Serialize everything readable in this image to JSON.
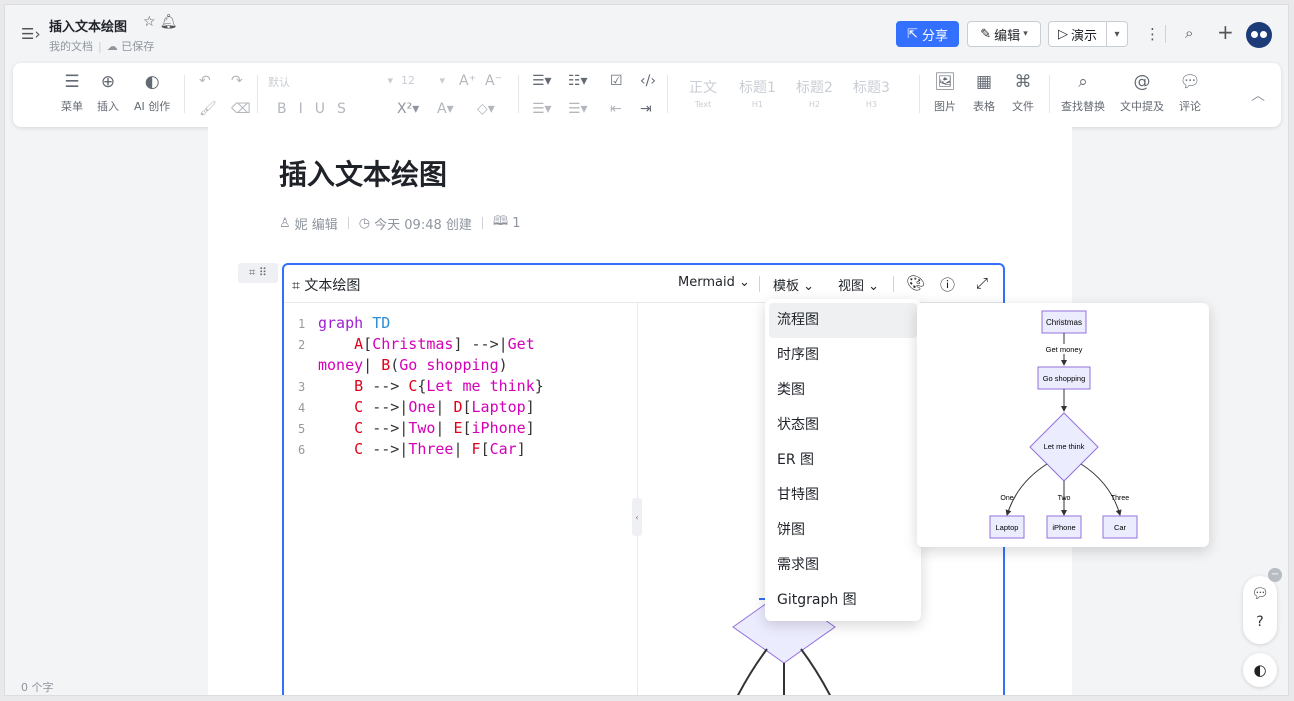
{
  "header": {
    "title": "插入文本绘图",
    "breadcrumb": "我的文档",
    "save_status": "已保存",
    "share_label": "分享",
    "edit_label": "编辑",
    "present_label": "演示"
  },
  "toolbar": {
    "menu": "菜单",
    "insert": "插入",
    "ai": "AI 创作",
    "font_placeholder": "默认",
    "font_size": "12",
    "headings": [
      {
        "label": "正文",
        "sub": "Text"
      },
      {
        "label": "标题1",
        "sub": "H1"
      },
      {
        "label": "标题2",
        "sub": "H2"
      },
      {
        "label": "标题3",
        "sub": "H3"
      }
    ],
    "image": "图片",
    "table": "表格",
    "file": "文件",
    "find_replace": "查找替换",
    "mention": "文中提及",
    "comment": "评论"
  },
  "doc": {
    "heading": "插入文本绘图",
    "author": "妮 编辑",
    "created": "今天 09:48 创建",
    "reads": "1"
  },
  "block": {
    "title": "文本绘图",
    "engine": "Mermaid",
    "template_label": "模板",
    "view_label": "视图"
  },
  "code": {
    "lines": [
      {
        "n": "1"
      },
      {
        "n": "2"
      },
      {
        "n": "3"
      },
      {
        "n": "4"
      },
      {
        "n": "5"
      },
      {
        "n": "6"
      }
    ]
  },
  "template_menu": {
    "items": [
      "流程图",
      "时序图",
      "类图",
      "状态图",
      "ER 图",
      "甘特图",
      "饼图",
      "需求图",
      "Gitgraph 图"
    ]
  },
  "diagram": {
    "nodes": {
      "a": "Christmas",
      "b": "Go shopping",
      "c": "Let me think",
      "d": "Laptop",
      "e": "iPhone",
      "f": "Car"
    },
    "edges": {
      "ab": "Get money",
      "cd": "One",
      "ce": "Two",
      "cf": "Three"
    }
  },
  "status": {
    "word_count": "0 个字"
  },
  "colors": {
    "accent": "#3370ff",
    "node_fill": "#ececff",
    "node_stroke": "#9370db"
  },
  "icons": [
    "menu-toggle-icon",
    "star-icon",
    "bell-icon",
    "share-icon",
    "pencil-icon",
    "present-icon",
    "more-icon",
    "search-icon",
    "plus-icon",
    "undo-icon",
    "redo-icon",
    "format-painter-icon",
    "eraser-icon",
    "image-icon",
    "table-icon",
    "attachment-icon",
    "find-icon",
    "at-icon",
    "comment-icon",
    "palette-icon",
    "help-icon",
    "expand-icon",
    "chevron-down-icon",
    "collapse-icon",
    "theme-icon"
  ]
}
